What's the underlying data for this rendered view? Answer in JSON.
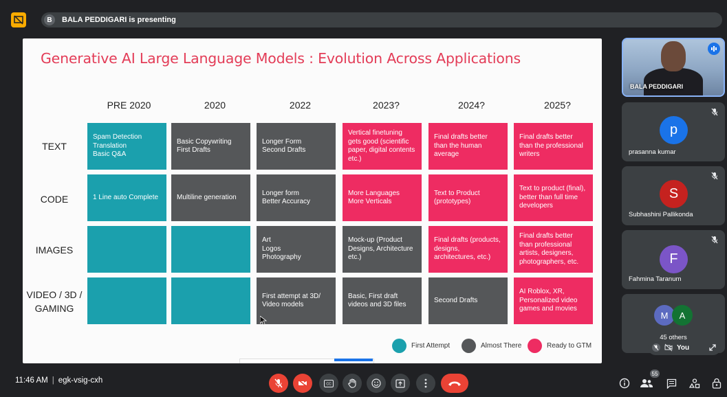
{
  "topbar": {
    "presenter_initial": "B",
    "presenter_text": "BALA PEDDIGARI is presenting"
  },
  "slide": {
    "title": "Generative AI Large Language Models : Evolution Across Applications",
    "columns": [
      "PRE 2020",
      "2020",
      "2022",
      "2023?",
      "2024?",
      "2025?"
    ],
    "rows": [
      {
        "label": "TEXT",
        "cells": [
          {
            "text": "Spam Detection\nTranslation\nBasic Q&A",
            "status": "teal"
          },
          {
            "text": "Basic Copywriting\nFirst Drafts",
            "status": "gray"
          },
          {
            "text": "Longer Form\nSecond Drafts",
            "status": "gray"
          },
          {
            "text": "Vertical finetuning gets good (scientific paper, digital contents etc.)",
            "status": "pink"
          },
          {
            "text": "Final drafts better than the human average",
            "status": "pink"
          },
          {
            "text": "Final drafts better than the professional writers",
            "status": "pink"
          }
        ]
      },
      {
        "label": "CODE",
        "cells": [
          {
            "text": "1 Line auto Complete",
            "status": "teal"
          },
          {
            "text": "Multiline generation",
            "status": "gray"
          },
          {
            "text": "Longer form\nBetter Accuracy",
            "status": "gray"
          },
          {
            "text": "More Languages\nMore Verticals",
            "status": "pink"
          },
          {
            "text": "Text to Product (prototypes)",
            "status": "pink"
          },
          {
            "text": "Text to product (final), better than full time developers",
            "status": "pink"
          }
        ]
      },
      {
        "label": "IMAGES",
        "cells": [
          {
            "text": "",
            "status": "teal"
          },
          {
            "text": "",
            "status": "teal"
          },
          {
            "text": "Art\nLogos\nPhotography",
            "status": "gray"
          },
          {
            "text": "Mock-up (Product Designs, Architecture etc.)",
            "status": "gray"
          },
          {
            "text": "Final drafts (products, designs, architectures, etc.)",
            "status": "pink"
          },
          {
            "text": "Final drafts better than professional artists, designers, photographers, etc.",
            "status": "pink"
          }
        ]
      },
      {
        "label": "VIDEO / 3D / GAMING",
        "cells": [
          {
            "text": "",
            "status": "teal"
          },
          {
            "text": "",
            "status": "teal"
          },
          {
            "text": "First attempt at 3D/ Video models",
            "status": "gray"
          },
          {
            "text": "Basic, First draft videos and 3D files",
            "status": "gray"
          },
          {
            "text": "Second Drafts",
            "status": "gray"
          },
          {
            "text": "AI Roblox, XR, Personalized video games and movies",
            "status": "pink"
          }
        ]
      }
    ],
    "legend": [
      {
        "label": "First Attempt",
        "color": "#1ba0ad"
      },
      {
        "label": "Almost There",
        "color": "#555759"
      },
      {
        "label": "Ready to GTM",
        "color": "#ee2c62"
      }
    ]
  },
  "participants": {
    "presenter": {
      "name": "BALA PEDDIGARI"
    },
    "tiles": [
      {
        "name": "prasanna kumar",
        "initial": "p",
        "color": "#1a73e8"
      },
      {
        "name": "Subhashini Pallikonda",
        "initial": "S",
        "color": "#c5221f"
      },
      {
        "name": "Fahmina Taranum",
        "initial": "F",
        "color": "#7b55c7"
      }
    ],
    "others": {
      "label": "45 others",
      "initials": [
        "M",
        "A"
      ],
      "colors": [
        "#5c6bc0",
        "#137333"
      ]
    },
    "self_label": "You"
  },
  "bottombar": {
    "time": "11:46 AM",
    "separator": "|",
    "meeting_code": "egk-vsig-cxh",
    "participant_count": "55"
  },
  "colors": {
    "teal": "#1ba0ad",
    "gray": "#555759",
    "pink": "#ee2c62",
    "title": "#e33c57",
    "end_call": "#ea4335"
  }
}
